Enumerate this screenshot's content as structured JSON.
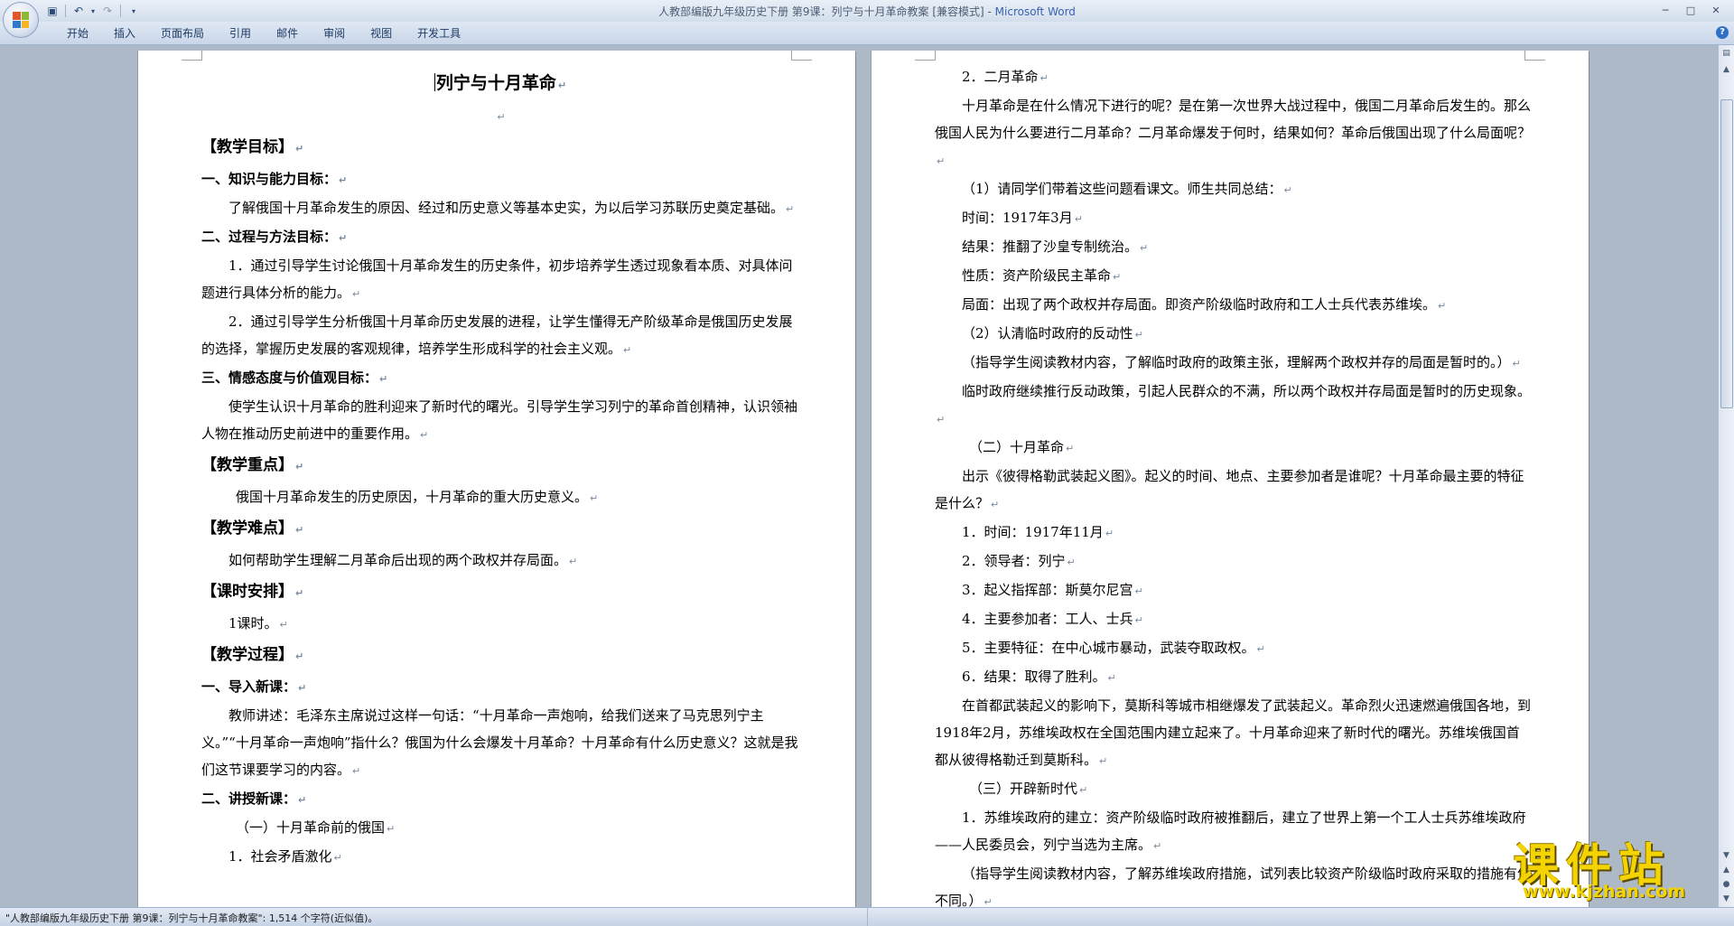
{
  "window": {
    "title_doc": "人教部编版九年级历史下册 第9课：列宁与十月革命教案 [兼容模式] - ",
    "title_app": "Microsoft Word",
    "minimize": "─",
    "restore": "□",
    "close": "✕"
  },
  "quick_access": {
    "save_icon": "save-icon",
    "undo_icon": "undo-icon",
    "redo_icon": "redo-icon"
  },
  "ribbon": {
    "tabs": [
      "开始",
      "插入",
      "页面布局",
      "引用",
      "邮件",
      "审阅",
      "视图",
      "开发工具"
    ],
    "help": "?"
  },
  "left_page": {
    "title": "列宁与十月革命",
    "lines": [
      {
        "text": "【教学目标】",
        "style": "section"
      },
      {
        "text": "一、知识与能力目标：",
        "style": "sub"
      },
      {
        "text": "了解俄国十月革命发生的原因、经过和历史意义等基本史实，为以后学习苏联历史奠定基础。",
        "style": "indent"
      },
      {
        "text": "二、过程与方法目标：",
        "style": "sub"
      },
      {
        "text": "1．通过引导学生讨论俄国十月革命发生的历史条件，初步培养学生透过现象看本质、对具体问题进行具体分析的能力。",
        "style": "indent"
      },
      {
        "text": "2．通过引导学生分析俄国十月革命历史发展的进程，让学生懂得无产阶级革命是俄国历史发展的选择，掌握历史发展的客观规律，培养学生形成科学的社会主义观。",
        "style": "indent"
      },
      {
        "text": "三、情感态度与价值观目标：",
        "style": "sub"
      },
      {
        "text": "使学生认识十月革命的胜利迎来了新时代的曙光。引导学生学习列宁的革命首创精神，认识领袖人物在推动历史前进中的重要作用。",
        "style": "indent"
      },
      {
        "text": "【教学重点】",
        "style": "section"
      },
      {
        "text": "俄国十月革命发生的历史原因，十月革命的重大历史意义。",
        "style": "indent2"
      },
      {
        "text": "【教学难点】",
        "style": "section"
      },
      {
        "text": "如何帮助学生理解二月革命后出现的两个政权并存局面。",
        "style": "indent3"
      },
      {
        "text": "【课时安排】",
        "style": "section"
      },
      {
        "text": "1课时。",
        "style": "indent3"
      },
      {
        "text": "【教学过程】",
        "style": "section"
      },
      {
        "text": "一、导入新课：",
        "style": "sub"
      },
      {
        "text": "教师讲述：毛泽东主席说过这样一句话：“十月革命一声炮响，给我们送来了马克思列宁主义。”“十月革命一声炮响”指什么？俄国为什么会爆发十月革命？十月革命有什么历史意义？这就是我们这节课要学习的内容。",
        "style": "indent"
      },
      {
        "text": "二、讲授新课：",
        "style": "sub"
      },
      {
        "text": "（一）十月革命前的俄国",
        "style": "indent2"
      },
      {
        "text": "1．社会矛盾激化",
        "style": "indent3"
      }
    ]
  },
  "right_page": {
    "lines": [
      {
        "text": "2．二月革命",
        "style": "indent3"
      },
      {
        "text": "十月革命是在什么情况下进行的呢？是在第一次世界大战过程中，俄国二月革命后发生的。那么俄国人民为什么要进行二月革命？二月革命爆发于何时，结果如何？革命后俄国出现了什么局面呢？",
        "style": "indent"
      },
      {
        "text": "（1）请同学们带着这些问题看课文。师生共同总结：",
        "style": "indent3"
      },
      {
        "text": "时间：1917年3月",
        "style": "indent3"
      },
      {
        "text": "结果：推翻了沙皇专制统治。",
        "style": "indent3"
      },
      {
        "text": "性质：资产阶级民主革命",
        "style": "indent3"
      },
      {
        "text": "局面：出现了两个政权并存局面。即资产阶级临时政府和工人士兵代表苏维埃。",
        "style": "indent3"
      },
      {
        "text": "（2）认清临时政府的反动性",
        "style": "indent3"
      },
      {
        "text": "（指导学生阅读教材内容，了解临时政府的政策主张，理解两个政权并存的局面是暂时的。）",
        "style": "indent"
      },
      {
        "text": "临时政府继续推行反动政策，引起人民群众的不满，所以两个政权并存局面是暂时的历史现象。",
        "style": "indent"
      },
      {
        "text": "（二）十月革命",
        "style": "indent2"
      },
      {
        "text": "出示《彼得格勒武装起义图》。起义的时间、地点、主要参加者是谁呢？十月革命最主要的特征是什么？",
        "style": "indent"
      },
      {
        "text": "1．时间：1917年11月",
        "style": "indent3"
      },
      {
        "text": "2．领导者：列宁",
        "style": "indent3"
      },
      {
        "text": "3．起义指挥部：斯莫尔尼宫",
        "style": "indent3"
      },
      {
        "text": "4．主要参加者：工人、士兵",
        "style": "indent3"
      },
      {
        "text": "5．主要特征：在中心城市暴动，武装夺取政权。",
        "style": "indent3"
      },
      {
        "text": "6．结果：取得了胜利。",
        "style": "indent3"
      },
      {
        "text": "在首都武装起义的影响下，莫斯科等城市相继爆发了武装起义。革命烈火迅速燃遍俄国各地，到1918年2月，苏维埃政权在全国范围内建立起来了。十月革命迎来了新时代的曙光。苏维埃俄国首都从彼得格勒迁到莫斯科。",
        "style": "indent"
      },
      {
        "text": "（三）开辟新时代",
        "style": "indent2"
      },
      {
        "text": "1．苏维埃政府的建立：资产阶级临时政府被推翻后，建立了世界上第一个工人士兵苏维埃政府——人民委员会，列宁当选为主席。",
        "style": "indent"
      },
      {
        "text": "（指导学生阅读教材内容，了解苏维埃政府措施，试列表比较资产阶级临时政府采取的措施有何不同。）",
        "style": "indent"
      }
    ]
  },
  "status_bar": {
    "text": "\"人教部编版九年级历史下册 第9课：列宁与十月革命教案\": 1,514 个字符(近似值)。"
  },
  "watermark": {
    "main": "课件站",
    "url": "www.kjzhan.com"
  }
}
